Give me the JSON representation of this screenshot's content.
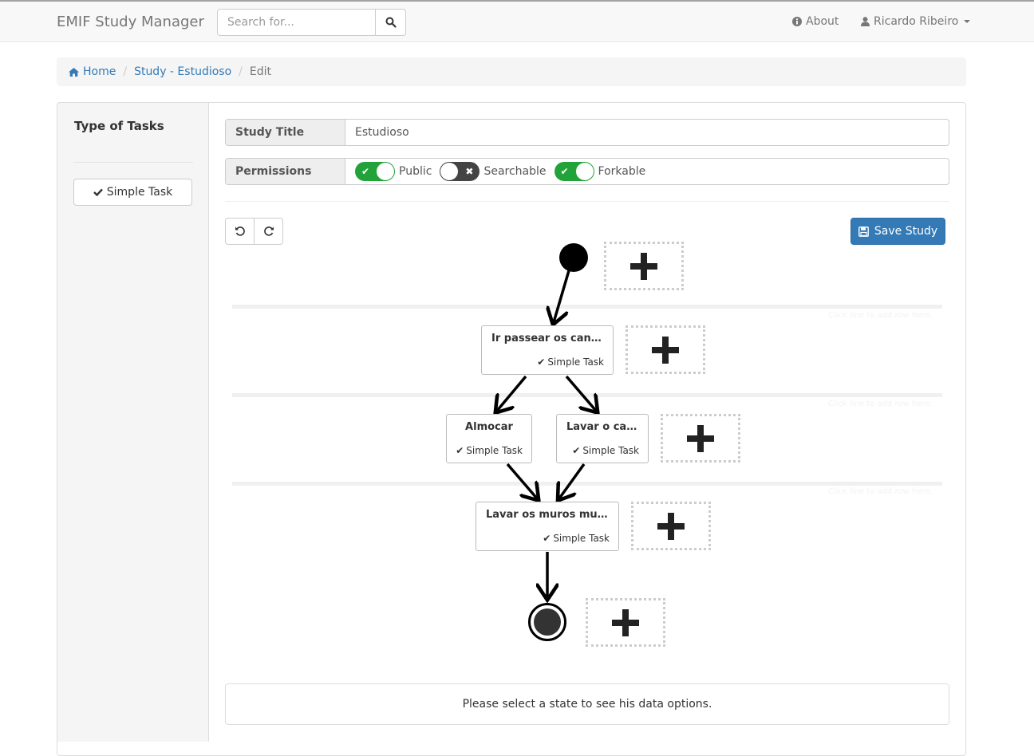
{
  "navbar": {
    "brand": "EMIF Study Manager",
    "search_placeholder": "Search for...",
    "about_label": "About",
    "user_label": "Ricardo Ribeiro"
  },
  "breadcrumb": {
    "home": "Home",
    "study": "Study - Estudioso",
    "current": "Edit"
  },
  "sidebar": {
    "title": "Type of Tasks",
    "task_types": [
      "Simple Task"
    ]
  },
  "form": {
    "study_title_label": "Study Title",
    "study_title_value": "Estudioso",
    "permissions_label": "Permissions",
    "permissions": [
      {
        "label": "Public",
        "enabled": true
      },
      {
        "label": "Searchable",
        "enabled": false
      },
      {
        "label": "Forkable",
        "enabled": true
      }
    ]
  },
  "toolbar": {
    "undo_icon": "undo-icon",
    "redo_icon": "redo-icon",
    "save_label": "Save Study"
  },
  "workflow": {
    "lane_hint": "Click line to add row here.",
    "tasks": [
      {
        "title": "Ir passear os canites",
        "type": "Simple Task"
      },
      {
        "title": "Almocar",
        "type": "Simple Task"
      },
      {
        "title": "Lavar o carro",
        "type": "Simple Task"
      },
      {
        "title": "Lavar os muros muito sujos",
        "type": "Simple Task"
      }
    ]
  },
  "info_panel": {
    "message": "Please select a state to see his data options."
  },
  "colors": {
    "primary": "#337ab7",
    "toggle_on": "#21a33a",
    "toggle_off": "#444444"
  }
}
